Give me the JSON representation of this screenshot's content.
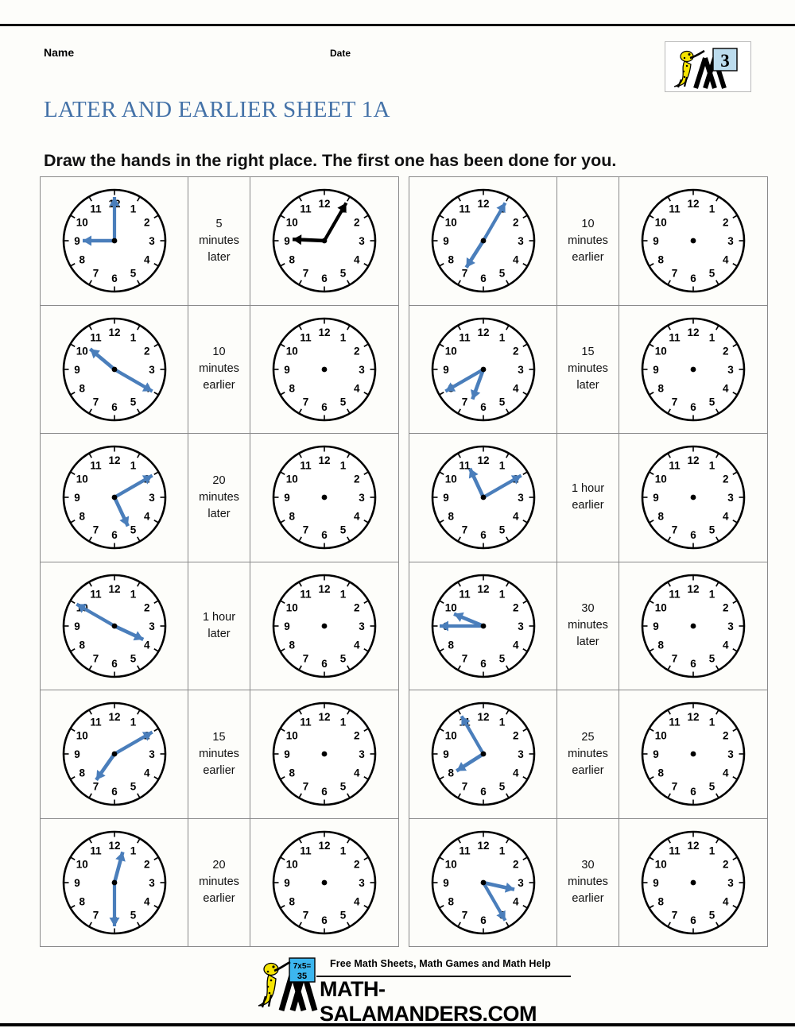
{
  "header": {
    "name_label": "Name",
    "date_label": "Date",
    "title": "LATER AND EARLIER SHEET 1A",
    "instruction": "Draw the hands in the right place. The first one has been done for you.",
    "logo_grade": "3"
  },
  "footer": {
    "tagline": "Free Math Sheets, Math Games and Math Help",
    "url": "MATH-SALAMANDERS.COM",
    "logo_sum_top": "7x5=",
    "logo_sum_bottom": "35"
  },
  "colors": {
    "title_blue": "#4472a8",
    "hand_blue": "#4a7ebb",
    "hand_black": "#000000",
    "clock_outline": "#000000",
    "grid_line": "#8a8a8a"
  },
  "clock_numerals": [
    "12",
    "1",
    "2",
    "3",
    "4",
    "5",
    "6",
    "7",
    "8",
    "9",
    "10",
    "11"
  ],
  "problems": [
    {
      "index": 1,
      "column": "left",
      "start_time": "9:00",
      "start_hour_angle": 270,
      "start_minute_angle": 0,
      "label": "5 minutes later",
      "label_lines": [
        "5",
        "minutes",
        "later"
      ],
      "answer_shown": true,
      "answer_time": "9:05",
      "answer_hour_angle": 272.5,
      "answer_minute_angle": 30,
      "hand_color": "#4a7ebb"
    },
    {
      "index": 2,
      "column": "right",
      "start_time": "7:05",
      "start_hour_angle": 212.5,
      "start_minute_angle": 30,
      "label": "10 minutes earlier",
      "label_lines": [
        "10",
        "minutes",
        "earlier"
      ],
      "answer_shown": false,
      "answer_time": "",
      "hand_color": "#4a7ebb"
    },
    {
      "index": 3,
      "column": "left",
      "start_time": "10:20",
      "start_hour_angle": 310,
      "start_minute_angle": 120,
      "label": "10 minutes earlier",
      "label_lines": [
        "10",
        "minutes",
        "earlier"
      ],
      "answer_shown": false,
      "answer_time": "",
      "hand_color": "#4a7ebb"
    },
    {
      "index": 4,
      "column": "right",
      "start_time": "6:40",
      "start_hour_angle": 200,
      "start_minute_angle": 240,
      "label": "15 minutes later",
      "label_lines": [
        "15",
        "minutes",
        "later"
      ],
      "answer_shown": false,
      "answer_time": "",
      "hand_color": "#4a7ebb"
    },
    {
      "index": 5,
      "column": "left",
      "start_time": "5:10",
      "start_hour_angle": 155,
      "start_minute_angle": 60,
      "label": "20 minutes later",
      "label_lines": [
        "20",
        "minutes",
        "later"
      ],
      "answer_shown": false,
      "answer_time": "",
      "hand_color": "#4a7ebb"
    },
    {
      "index": 6,
      "column": "right",
      "start_time": "11:10",
      "start_hour_angle": 335,
      "start_minute_angle": 60,
      "label": "1 hour earlier",
      "label_lines": [
        "1 hour",
        "earlier"
      ],
      "answer_shown": false,
      "answer_time": "",
      "hand_color": "#4a7ebb"
    },
    {
      "index": 7,
      "column": "left",
      "start_time": "3:50",
      "start_hour_angle": 115,
      "start_minute_angle": 300,
      "label": "1 hour later",
      "label_lines": [
        "1 hour",
        "later"
      ],
      "answer_shown": false,
      "answer_time": "",
      "hand_color": "#4a7ebb"
    },
    {
      "index": 8,
      "column": "right",
      "start_time": "9:45",
      "start_hour_angle": 292.5,
      "start_minute_angle": 270,
      "label": "30 minutes later",
      "label_lines": [
        "30",
        "minutes",
        "later"
      ],
      "answer_shown": false,
      "answer_time": "",
      "hand_color": "#4a7ebb"
    },
    {
      "index": 9,
      "column": "left",
      "start_time": "7:10",
      "start_hour_angle": 215,
      "start_minute_angle": 60,
      "label": "15 minutes earlier",
      "label_lines": [
        "15",
        "minutes",
        "earlier"
      ],
      "answer_shown": false,
      "answer_time": "",
      "hand_color": "#4a7ebb"
    },
    {
      "index": 10,
      "column": "right",
      "start_time": "7:55",
      "start_hour_angle": 237.5,
      "start_minute_angle": 330,
      "label": "25 minutes earlier",
      "label_lines": [
        "25",
        "minutes",
        "earlier"
      ],
      "answer_shown": false,
      "answer_time": "",
      "hand_color": "#4a7ebb"
    },
    {
      "index": 11,
      "column": "left",
      "start_time": "12:30",
      "start_hour_angle": 15,
      "start_minute_angle": 180,
      "label": "20 minutes earlier",
      "label_lines": [
        "20",
        "minutes",
        "earlier"
      ],
      "answer_shown": false,
      "answer_time": "",
      "hand_color": "#4a7ebb"
    },
    {
      "index": 12,
      "column": "right",
      "start_time": "3:25",
      "start_hour_angle": 102.5,
      "start_minute_angle": 150,
      "label": "30 minutes earlier",
      "label_lines": [
        "30",
        "minutes",
        "earlier"
      ],
      "answer_shown": false,
      "answer_time": "",
      "hand_color": "#4a7ebb"
    }
  ]
}
